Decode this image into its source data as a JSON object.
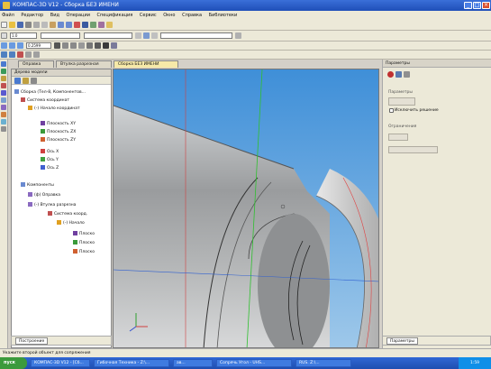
{
  "window": {
    "title": "КОМПАС-3D V12 - Сборка БЕЗ ИМЕНИ"
  },
  "menu": [
    "Файл",
    "Редактор",
    "Вид",
    "Операции",
    "Спецификация",
    "Сервис",
    "Окно",
    "Справка",
    "Библиотеки"
  ],
  "toolbar": {
    "scale_value": "1.0",
    "zoom_value": "0.2599"
  },
  "doc_tabs": [
    "Оправка",
    "Втулка разрезная",
    "Сборка БЕЗ ИМЕНИ"
  ],
  "tree": {
    "title": "Дерево модели",
    "nodes": [
      "Сборка (Тел-8, Компонентов...",
      "Система координат",
      "(-) Начало координат",
      "Плоскость XY",
      "Плоскость ZX",
      "Плоскость ZY",
      "Ось X",
      "Ось Y",
      "Ось Z",
      "Компоненты",
      "(ф) Оправка",
      "(-) Втулка разрезна",
      "Система коорд.",
      "(-) Начало",
      "Плоско",
      "Плоско",
      "Плоско"
    ],
    "bottom_tab": "Построение"
  },
  "props": {
    "title": "Параметры",
    "section1": "Параметры",
    "option_label": "Исключить решение",
    "section2": "Ограничения",
    "bottom_tab": "Параметры"
  },
  "status": {
    "text": "Укажите второй объект для сопряжения"
  },
  "taskbar": {
    "start": "пуск",
    "tasks": [
      "КОМПАС-3D V12 - [Сб...",
      "Гибочная Техника - Z:\\...",
      "ав...",
      "Сопрячь Угол - UHS...",
      "RUS. Z:\\..."
    ],
    "clock": "1:59"
  },
  "colors": {
    "titlebar": "#1f4fb8",
    "active_tab": "#f6e9a8",
    "sky": "#3f8fd8"
  }
}
